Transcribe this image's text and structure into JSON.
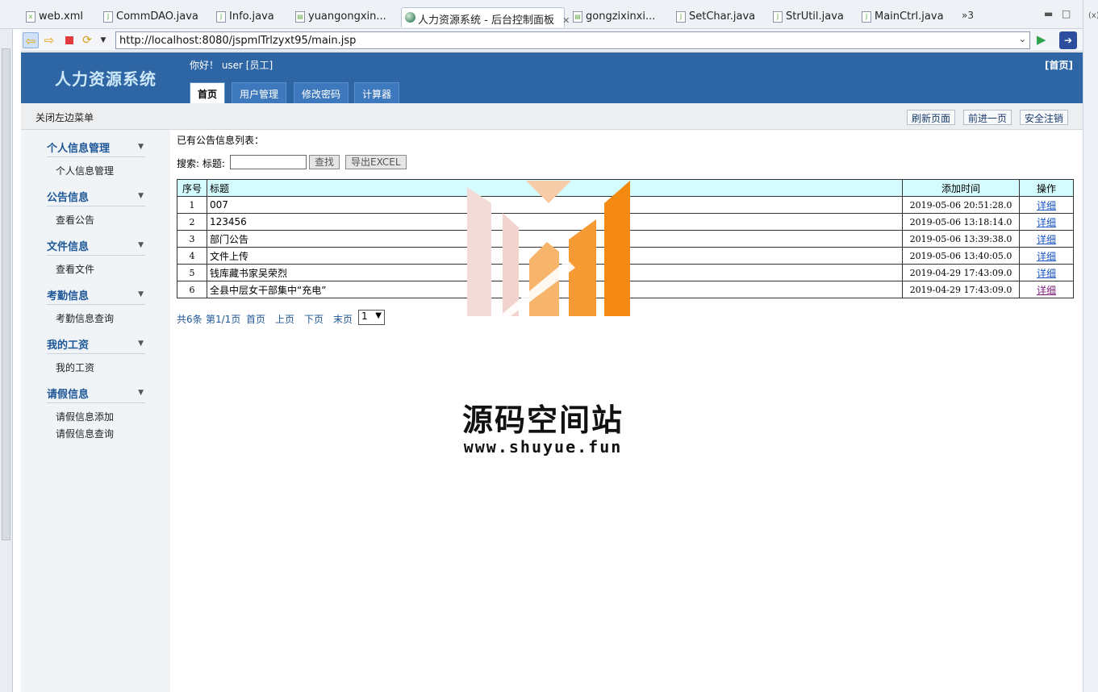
{
  "ide": {
    "tabs": [
      {
        "label": "web.xml",
        "icon": "xml-file-icon",
        "active": false
      },
      {
        "label": "CommDAO.java",
        "icon": "java-file-icon",
        "active": false
      },
      {
        "label": "Info.java",
        "icon": "java-file-icon",
        "active": false
      },
      {
        "label": "yuangongxin...",
        "icon": "jsp-file-icon",
        "active": false
      },
      {
        "label": "人力资源系统 - 后台控制面板",
        "icon": "globe-icon",
        "active": true
      },
      {
        "label": "gongzixinxi...",
        "icon": "jsp-file-icon",
        "active": false
      },
      {
        "label": "SetChar.java",
        "icon": "java-file-icon",
        "active": false
      },
      {
        "label": "StrUtil.java",
        "icon": "java-file-icon",
        "active": false
      },
      {
        "label": "MainCtrl.java",
        "icon": "java-file-icon",
        "active": false
      }
    ],
    "overflow_count": "»3",
    "right_edge_label": "(x)",
    "tab_close_glyph": "✕"
  },
  "browser": {
    "url": "http://localhost:8080/jspmlTrlzyxt95/main.jsp"
  },
  "app": {
    "title": "人力资源系统",
    "greeting": "你好！ user [员工]",
    "home_link": "[首页]",
    "nav_tabs": [
      "首页",
      "用户管理",
      "修改密码",
      "计算器"
    ],
    "close_menu": "关闭左边菜单",
    "toolbar_buttons": [
      "刷新页面",
      "前进一页",
      "安全注销"
    ]
  },
  "sidebar": {
    "groups": [
      {
        "title": "个人信息管理",
        "items": [
          "个人信息管理"
        ]
      },
      {
        "title": "公告信息",
        "items": [
          "查看公告"
        ]
      },
      {
        "title": "文件信息",
        "items": [
          "查看文件"
        ]
      },
      {
        "title": "考勤信息",
        "items": [
          "考勤信息查询"
        ]
      },
      {
        "title": "我的工资",
        "items": [
          "我的工资"
        ]
      },
      {
        "title": "请假信息",
        "items": [
          "请假信息添加",
          "请假信息查询"
        ]
      }
    ]
  },
  "content": {
    "list_title": "已有公告信息列表：",
    "search_label": "搜索: 标题:",
    "search_value": "",
    "search_button": "查找",
    "export_button": "导出EXCEL",
    "table": {
      "headers": [
        "序号",
        "标题",
        "添加时间",
        "操作"
      ],
      "rows": [
        {
          "no": "1",
          "title": "007",
          "time": "2019-05-06 20:51:28.0",
          "op": "详细"
        },
        {
          "no": "2",
          "title": "123456",
          "time": "2019-05-06 13:18:14.0",
          "op": "详细"
        },
        {
          "no": "3",
          "title": "部门公告",
          "time": "2019-05-06 13:39:38.0",
          "op": "详细"
        },
        {
          "no": "4",
          "title": "文件上传",
          "time": "2019-05-06 13:40:05.0",
          "op": "详细"
        },
        {
          "no": "5",
          "title": "钱库藏书家吴荣烈",
          "time": "2019-04-29 17:43:09.0",
          "op": "详细"
        },
        {
          "no": "6",
          "title": "全县中层女干部集中“充电”",
          "time": "2019-04-29 17:43:09.0",
          "op": "详细"
        }
      ]
    },
    "pager": {
      "total": "共6条",
      "page_info": "第1/1页",
      "first": "首页",
      "prev": "上页",
      "next": "下页",
      "last": "末页",
      "page_select": "1"
    }
  },
  "watermark": {
    "text": "源码空间站",
    "url": "www.shuyue.fun"
  },
  "colors": {
    "header_blue": "#2e66a5",
    "table_header": "#d4fbfd",
    "link_blue": "#1a55c4",
    "visited_link": "#7a1d7a",
    "watermark_orange": "#f48a12"
  }
}
